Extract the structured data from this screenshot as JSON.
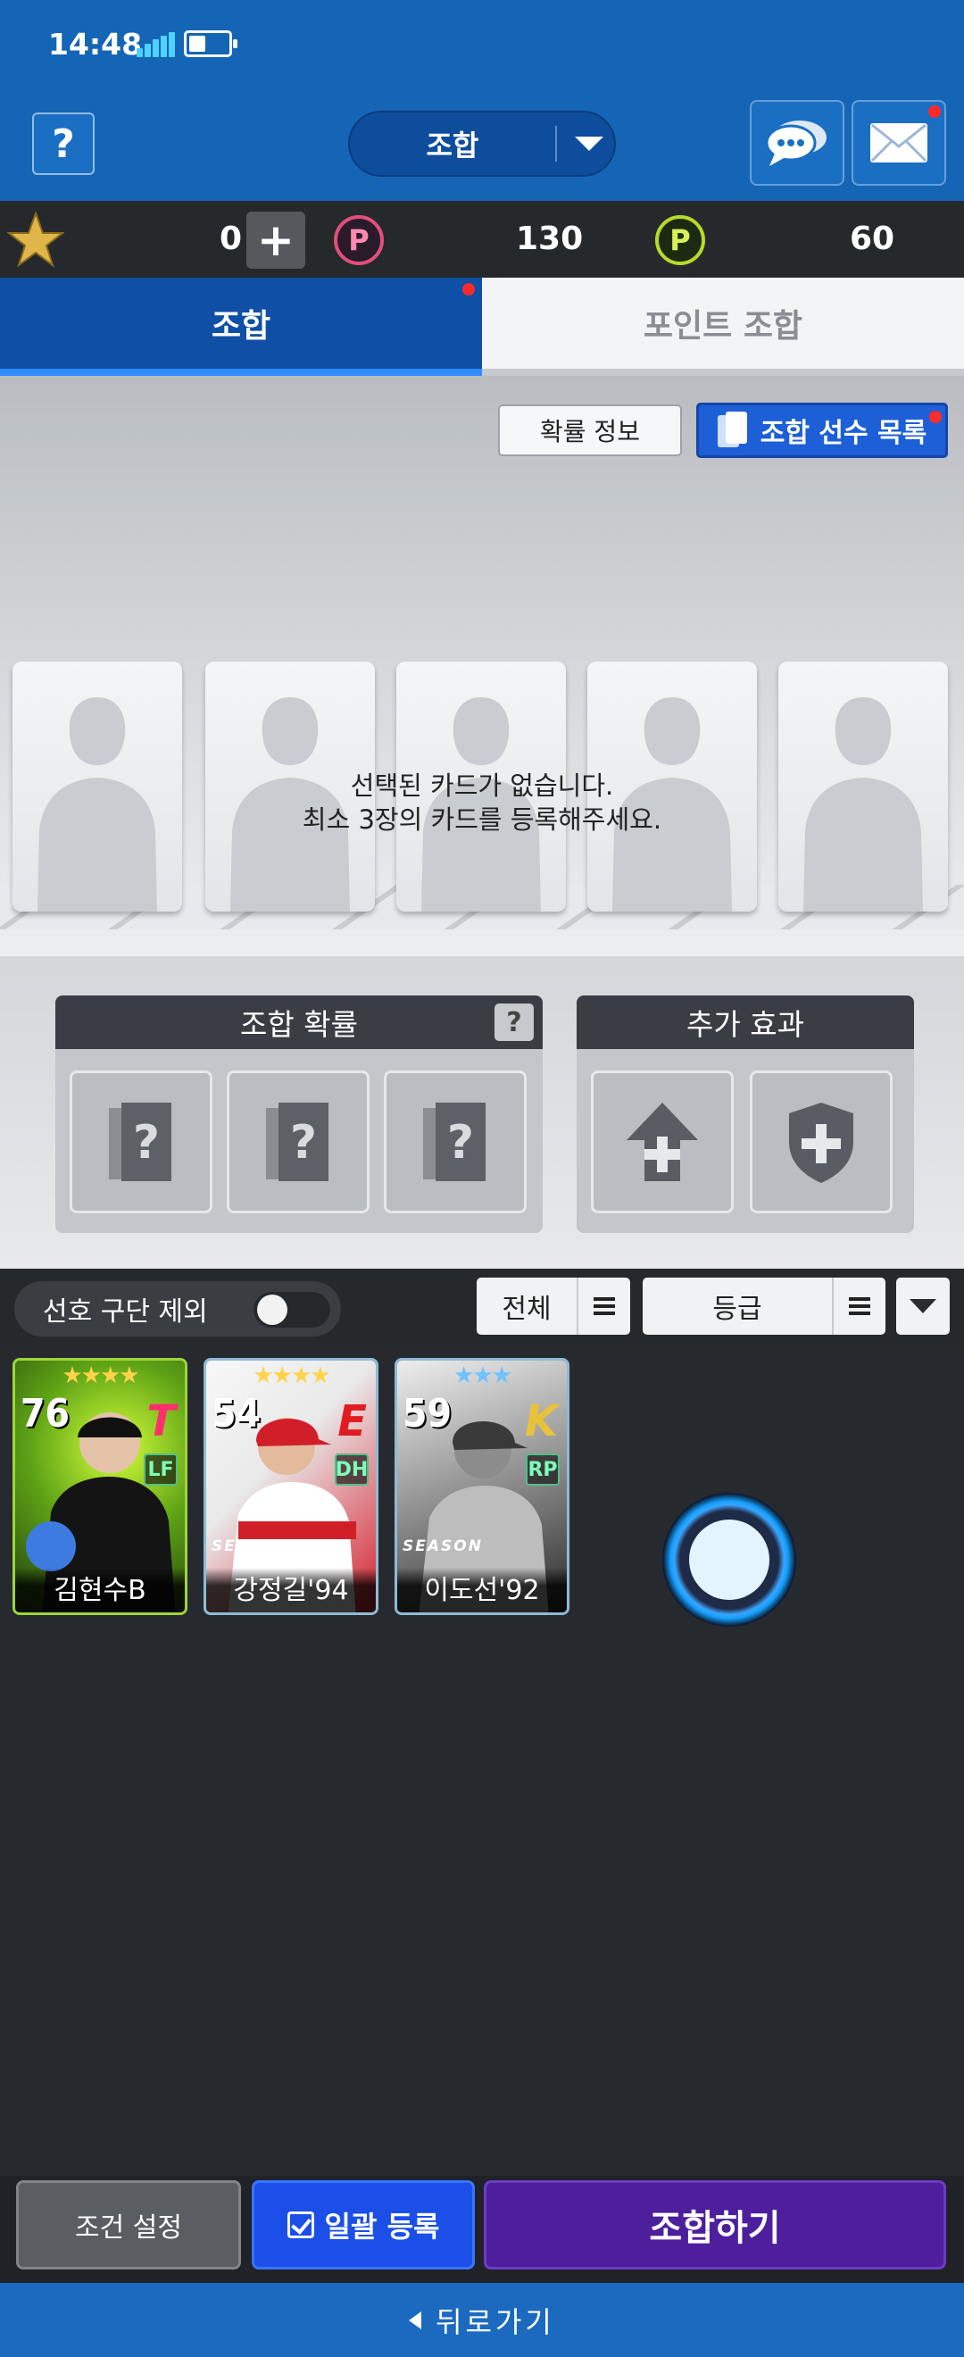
{
  "status": {
    "time": "14:48"
  },
  "header": {
    "help_label": "?",
    "mode_label": "조합"
  },
  "currency": {
    "stars": "0",
    "plus_label": "+",
    "p_red": "130",
    "p_green": "60",
    "coin_letter": "P"
  },
  "tabs": [
    {
      "label": "조합",
      "active": true
    },
    {
      "label": "포인트 조합",
      "active": false
    }
  ],
  "slots": {
    "prob_info_label": "확률 정보",
    "player_list_label": "조합 선수 목록",
    "empty_line1": "선택된 카드가 없습니다.",
    "empty_line2": "최소 3장의 카드를 등록해주세요."
  },
  "panels": {
    "prob_title": "조합 확률",
    "prob_help": "?",
    "effect_title": "추가 효과",
    "slot_mark": "?"
  },
  "filter": {
    "pref_label": "선호 구단 제외",
    "all_label": "전체",
    "grade_label": "등급"
  },
  "cards": [
    {
      "name": "김현수B",
      "ovr": "76",
      "pos": "LF",
      "stars": "★★★★",
      "team": "T",
      "season": ""
    },
    {
      "name": "강정길'94",
      "ovr": "54",
      "pos": "DH",
      "stars": "★★★★",
      "team": "E",
      "season": "SEASON"
    },
    {
      "name": "이도선'92",
      "ovr": "59",
      "pos": "RP",
      "stars": "★★★",
      "team": "K",
      "season": "SEASON"
    }
  ],
  "bottom": {
    "condition_label": "조건 설정",
    "bulk_label": "일괄 등록",
    "combine_label": "조합하기",
    "back_label": "뒤로가기"
  },
  "colors": {
    "header_blue": "#1565b6",
    "active_tab": "#0f4fa5",
    "combine_purple": "#4d1f9c",
    "bulk_blue": "#1b4fe8"
  }
}
